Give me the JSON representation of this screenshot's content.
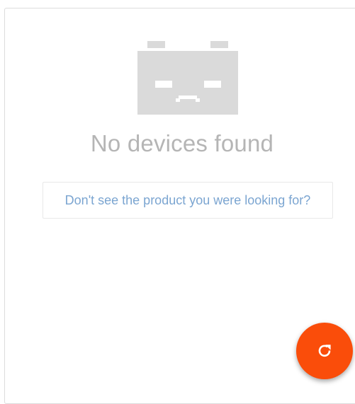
{
  "empty_state": {
    "icon": "sad-device-icon",
    "title": "No devices found",
    "help_link": "Don't see the product you were looking for?"
  },
  "actions": {
    "refresh_icon": "refresh-icon"
  },
  "colors": {
    "illustration": "#dadada",
    "title_text": "#b5b5b5",
    "link_text": "#7ba5d1",
    "fab_background": "#fa4d0a"
  }
}
